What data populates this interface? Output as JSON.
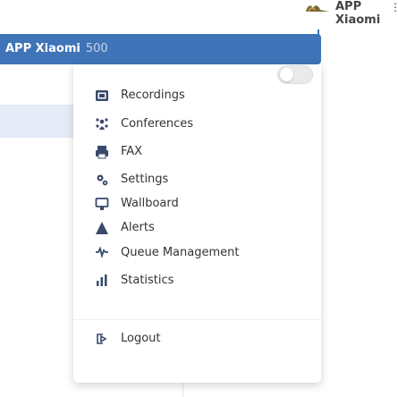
{
  "topbar": {
    "app_name": "APP Xiaomi",
    "kebab": "⋮"
  },
  "header": {
    "user_name": "APP Xiaomi",
    "extension": "500"
  },
  "menu": {
    "items": [
      {
        "label": "Recordings",
        "icon": "recordings-icon"
      },
      {
        "label": "Conferences",
        "icon": "conferences-icon"
      },
      {
        "label": "FAX",
        "icon": "fax-icon"
      },
      {
        "label": "Settings",
        "icon": "settings-icon"
      },
      {
        "label": "Wallboard",
        "icon": "wallboard-icon"
      },
      {
        "label": "Alerts",
        "icon": "alerts-icon"
      },
      {
        "label": "Queue Management",
        "icon": "queue-management-icon"
      },
      {
        "label": "Statistics",
        "icon": "statistics-icon"
      },
      {
        "label": "Logout",
        "icon": "logout-icon"
      }
    ]
  },
  "colors": {
    "header_bg": "#3f74b8",
    "icon": "#3a4a6b",
    "text": "#333333"
  }
}
